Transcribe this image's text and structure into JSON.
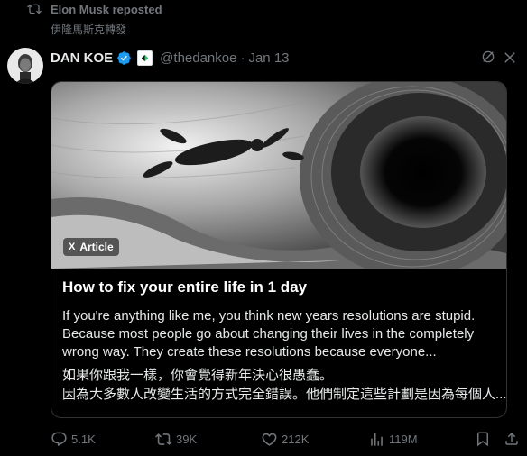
{
  "repost": {
    "text": "Elon Musk reposted",
    "icon": "repost-icon"
  },
  "translate_label": "伊隆馬斯克轉發",
  "author": {
    "name": "DAN KOE",
    "handle": "@thedankoe",
    "date": "Jan 13"
  },
  "card": {
    "badge_prefix": "X",
    "badge_label": "Article",
    "title": "How to fix your entire life in 1 day",
    "excerpt": "If you're anything like me, you think new years resolutions are stupid. Because most people go about changing their lives in the completely wrong way. They create these resolutions because everyone...",
    "translation_line1": "如果你跟我一樣，你會覺得新年決心很愚蠢。",
    "translation_line2": "因為大多數人改變生活的方式完全錯誤。他們制定這些計劃是因為每個人..."
  },
  "actions": {
    "replies": "5.1K",
    "reposts": "39K",
    "likes": "212K",
    "views": "119M"
  },
  "colors": {
    "background": "#000000",
    "muted": "#71767b",
    "verified": "#1d9bf0",
    "text": "#e7e9ea",
    "border": "#2f3336"
  }
}
